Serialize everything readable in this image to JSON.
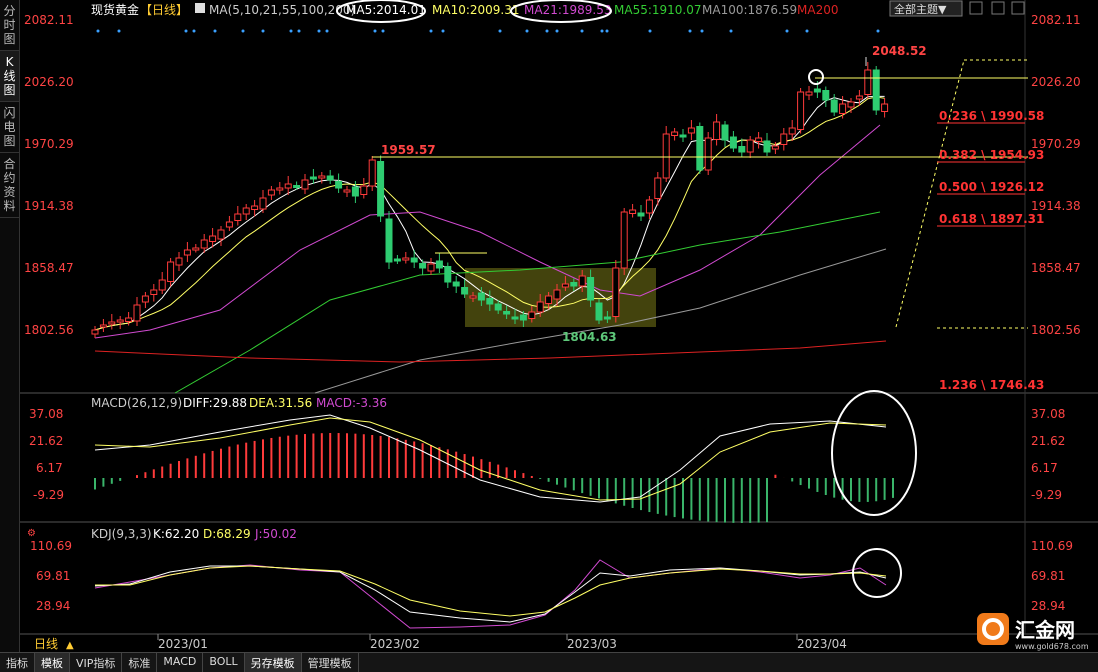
{
  "sidebar": {
    "tabs": [
      "分时图",
      "K线图",
      "闪电图",
      "合约资料"
    ],
    "active": 1
  },
  "header": {
    "instrument": "现货黄金",
    "period_tag": "【日线】",
    "ma_label": "MA(5,10,21,55,100,200)",
    "ma5": "MA5:2014.01",
    "ma10": "MA10:2009.31",
    "ma21": "MA21:1989.53",
    "ma55": "MA55:1910.07",
    "ma100": "MA100:1876.59",
    "ma200": "MA200",
    "theme_select": "全部主题▼"
  },
  "price_axis": [
    "2082.11",
    "2026.20",
    "1970.29",
    "1914.38",
    "1858.47",
    "1802.56"
  ],
  "annotations": {
    "high_label": "2048.52",
    "low_label": "1804.63",
    "swing_label": "1959.57",
    "fib": [
      "0.236 \\ 1990.58",
      "0.382 \\ 1954.93",
      "0.500 \\ 1926.12",
      "0.618 \\ 1897.31",
      "1.236 \\ 1746.43"
    ]
  },
  "macd": {
    "label": "MACD(26,12,9)",
    "diff": "DIFF:29.88",
    "dea": "DEA:31.56",
    "macd": "MACD:-3.36",
    "axis": [
      "37.08",
      "21.62",
      "6.17",
      "-9.29"
    ]
  },
  "kdj": {
    "label": "KDJ(9,3,3)",
    "k": "K:62.20",
    "d": "D:68.29",
    "j": "J:50.02",
    "axis": [
      "110.69",
      "69.81",
      "28.94"
    ]
  },
  "time_axis": {
    "period": "日线",
    "months": [
      "2023/01",
      "2023/02",
      "2023/03",
      "2023/04"
    ]
  },
  "bottom_tabs": [
    "指标",
    "模板",
    "VIP指标",
    "标准",
    "MACD",
    "BOLL",
    "另存模板",
    "管理模板"
  ],
  "logo": {
    "text": "汇金网",
    "url_text": "www.gold678.com"
  },
  "colors": {
    "up": "#ff3b3b",
    "down": "#2ecc71",
    "ma5": "#ffffff",
    "ma10": "#ffff66",
    "ma21": "#d04ad0",
    "ma55": "#33cc33",
    "ma100": "#999999",
    "ma200": "#dd2222"
  }
}
